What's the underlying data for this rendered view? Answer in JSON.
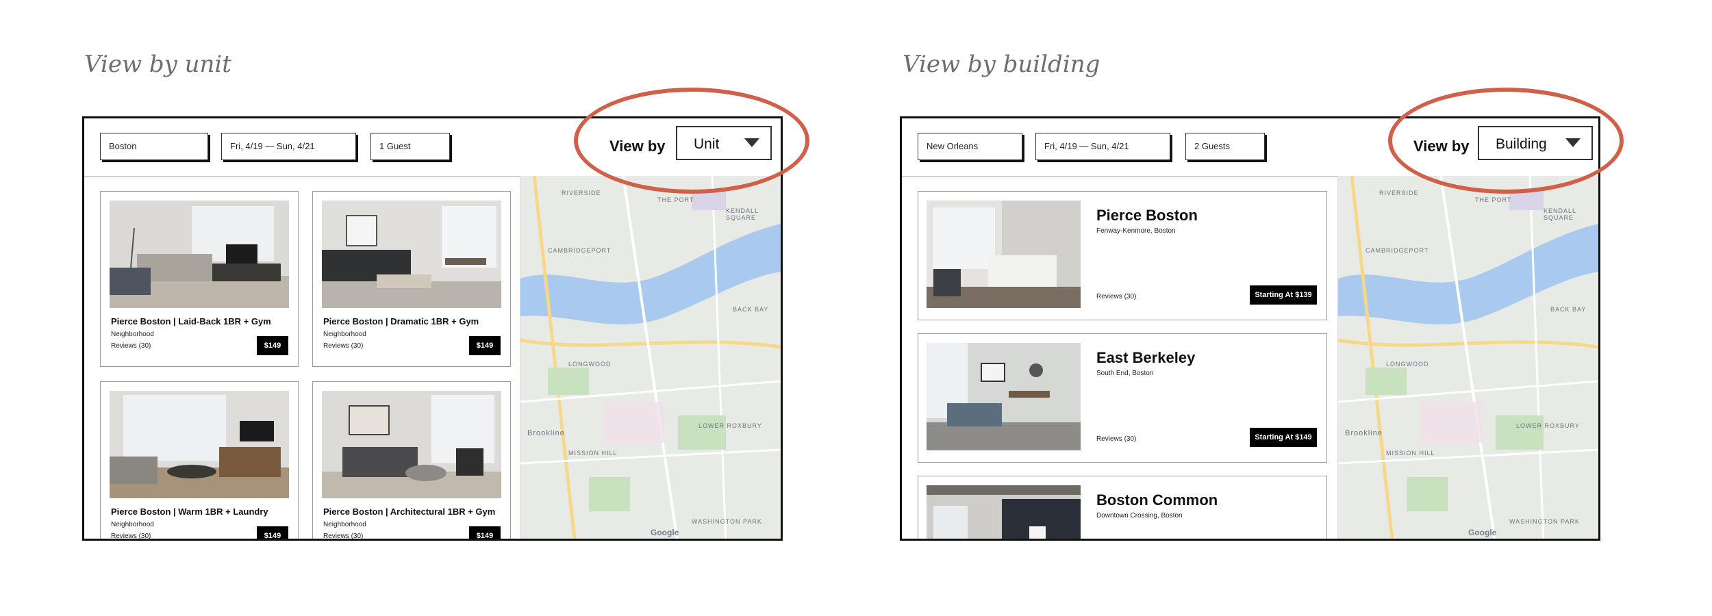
{
  "left": {
    "caption": "View by unit",
    "search": {
      "location": "Boston",
      "dates": "Fri, 4/19 — Sun, 4/21",
      "guests": "1 Guest"
    },
    "view_by": {
      "label": "View by",
      "selected": "Unit"
    },
    "units": [
      {
        "title": "Pierce Boston | Laid-Back 1BR + Gym",
        "neighborhood": "Neighborhood",
        "reviews": "Reviews (30)",
        "price": "$149"
      },
      {
        "title": "Pierce Boston | Dramatic 1BR + Gym",
        "neighborhood": "Neighborhood",
        "reviews": "Reviews (30)",
        "price": "$149"
      },
      {
        "title": "Pierce Boston | Warm 1BR + Laundry",
        "neighborhood": "Neighborhood",
        "reviews": "Reviews (30)",
        "price": "$149"
      },
      {
        "title": "Pierce Boston | Architectural 1BR + Gym",
        "neighborhood": "Neighborhood",
        "reviews": "Reviews (30)",
        "price": "$149"
      }
    ]
  },
  "right": {
    "caption": "View by building",
    "search": {
      "location": "New Orleans",
      "dates": "Fri, 4/19 — Sun, 4/21",
      "guests": "2 Guests"
    },
    "view_by": {
      "label": "View by",
      "selected": "Building"
    },
    "buildings": [
      {
        "name": "Pierce Boston",
        "area": "Fenway-Kenmore, Boston",
        "reviews": "Reviews (30)",
        "price": "Starting At $139"
      },
      {
        "name": "East Berkeley",
        "area": "South End, Boston",
        "reviews": "Reviews (30)",
        "price": "Starting At $149"
      },
      {
        "name": "Boston Common",
        "area": "Downtown Crossing, Boston"
      }
    ]
  },
  "map": {
    "labels": [
      "RIVERSIDE",
      "THE PORT",
      "KENDALL SQUARE",
      "CAMBRIDGEPORT",
      "BACK BAY",
      "LONGWOOD",
      "MISSION HILL",
      "Brookline",
      "LOWER ROXBURY",
      "WASHINGTON PARK"
    ],
    "watermark": "Google"
  },
  "colors": {
    "highlight": "#d0604a",
    "price_bg": "#000000"
  }
}
